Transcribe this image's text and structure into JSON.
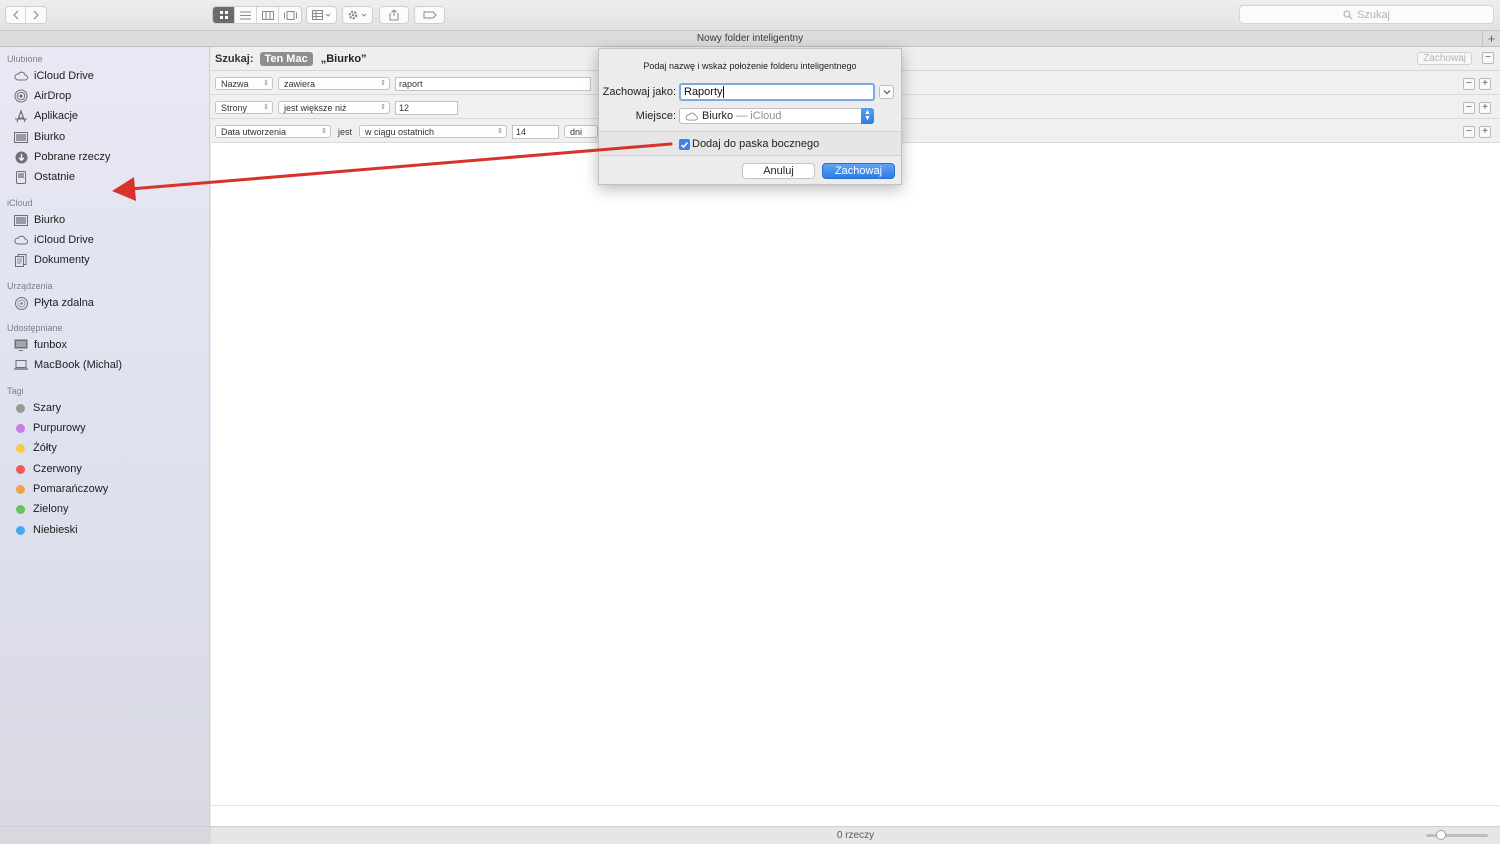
{
  "window": {
    "title": "Nowy folder inteligentny"
  },
  "toolbar": {
    "search_placeholder": "Szukaj"
  },
  "sidebar": {
    "sections": [
      {
        "header": "Ulubione",
        "items": [
          {
            "label": "iCloud Drive",
            "icon": "cloud-icon"
          },
          {
            "label": "AirDrop",
            "icon": "airdrop-icon"
          },
          {
            "label": "Aplikacje",
            "icon": "applications-icon"
          },
          {
            "label": "Biurko",
            "icon": "desktop-icon"
          },
          {
            "label": "Pobrane rzeczy",
            "icon": "download-icon"
          },
          {
            "label": "Ostatnie",
            "icon": "recents-icon"
          }
        ]
      },
      {
        "header": "iCloud",
        "items": [
          {
            "label": "Biurko",
            "icon": "desktop-icon"
          },
          {
            "label": "iCloud Drive",
            "icon": "cloud-icon"
          },
          {
            "label": "Dokumenty",
            "icon": "documents-icon"
          }
        ]
      },
      {
        "header": "Urządzenia",
        "items": [
          {
            "label": "Płyta zdalna",
            "icon": "remote-disc-icon"
          }
        ]
      },
      {
        "header": "Udostępniane",
        "items": [
          {
            "label": "funbox",
            "icon": "display-icon"
          },
          {
            "label": "MacBook (Michal)",
            "icon": "laptop-icon"
          }
        ]
      },
      {
        "header": "Tagi",
        "items": [
          {
            "label": "Szary",
            "color": "#9a9a9a"
          },
          {
            "label": "Purpurowy",
            "color": "#c97ee0"
          },
          {
            "label": "Żółty",
            "color": "#f6cc4a"
          },
          {
            "label": "Czerwony",
            "color": "#ee5a55"
          },
          {
            "label": "Pomarańczowy",
            "color": "#f3a24a"
          },
          {
            "label": "Zielony",
            "color": "#66c456"
          },
          {
            "label": "Niebieski",
            "color": "#4aa7ee"
          }
        ]
      }
    ]
  },
  "search": {
    "label": "Szukaj:",
    "scope_active": "Ten Mac",
    "scope_other": "„Biurko”",
    "save_label": "Zachowaj"
  },
  "criteria": [
    {
      "attribute": "Nazwa",
      "operator": "zawiera",
      "value": "raport"
    },
    {
      "attribute": "Strony",
      "operator": "jest większe niż",
      "value": "12"
    },
    {
      "attribute": "Data utworzenia",
      "mid_label": "jest",
      "operator": "w ciągu ostatnich",
      "value": "14",
      "unit": "dni"
    }
  ],
  "dialog": {
    "prompt": "Podaj nazwę i wskaż położenie folderu inteligentnego",
    "save_as_label": "Zachowaj jako:",
    "save_as_value": "Raporty",
    "location_label": "Miejsce:",
    "location_main": "Biurko",
    "location_sub": "— iCloud",
    "checkbox_label": "Dodaj do paska bocznego",
    "checkbox_checked": true,
    "cancel_label": "Anuluj",
    "save_label": "Zachowaj"
  },
  "status": {
    "items_count": "0 rzeczy"
  },
  "colors": {
    "accent": "#2f7ce6",
    "arrow": "#d8322c"
  }
}
